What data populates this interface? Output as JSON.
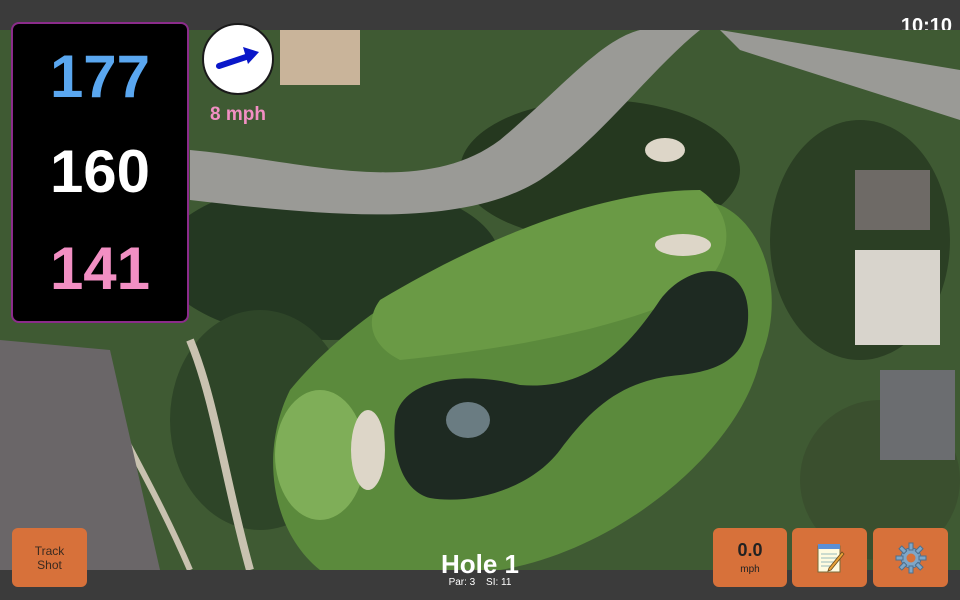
{
  "status": {
    "clock": "10:10"
  },
  "distances": {
    "back": "177",
    "middle": "160",
    "front": "141"
  },
  "wind": {
    "speed_label": "8 mph",
    "direction_icon": "wind-arrow-icon"
  },
  "hole": {
    "title": "Hole 1",
    "par_label": "Par: 3",
    "si_label": "SI: 11"
  },
  "buttons": {
    "track_shot_line1": "Track",
    "track_shot_line2": "Shot",
    "speed_value": "0.0",
    "speed_unit": "mph",
    "notes_icon": "notepad-icon",
    "settings_icon": "gear-icon"
  },
  "colors": {
    "back_distance": "#5aa7f0",
    "middle_distance": "#ffffff",
    "front_distance": "#f28fc3",
    "button": "#d7713a"
  }
}
